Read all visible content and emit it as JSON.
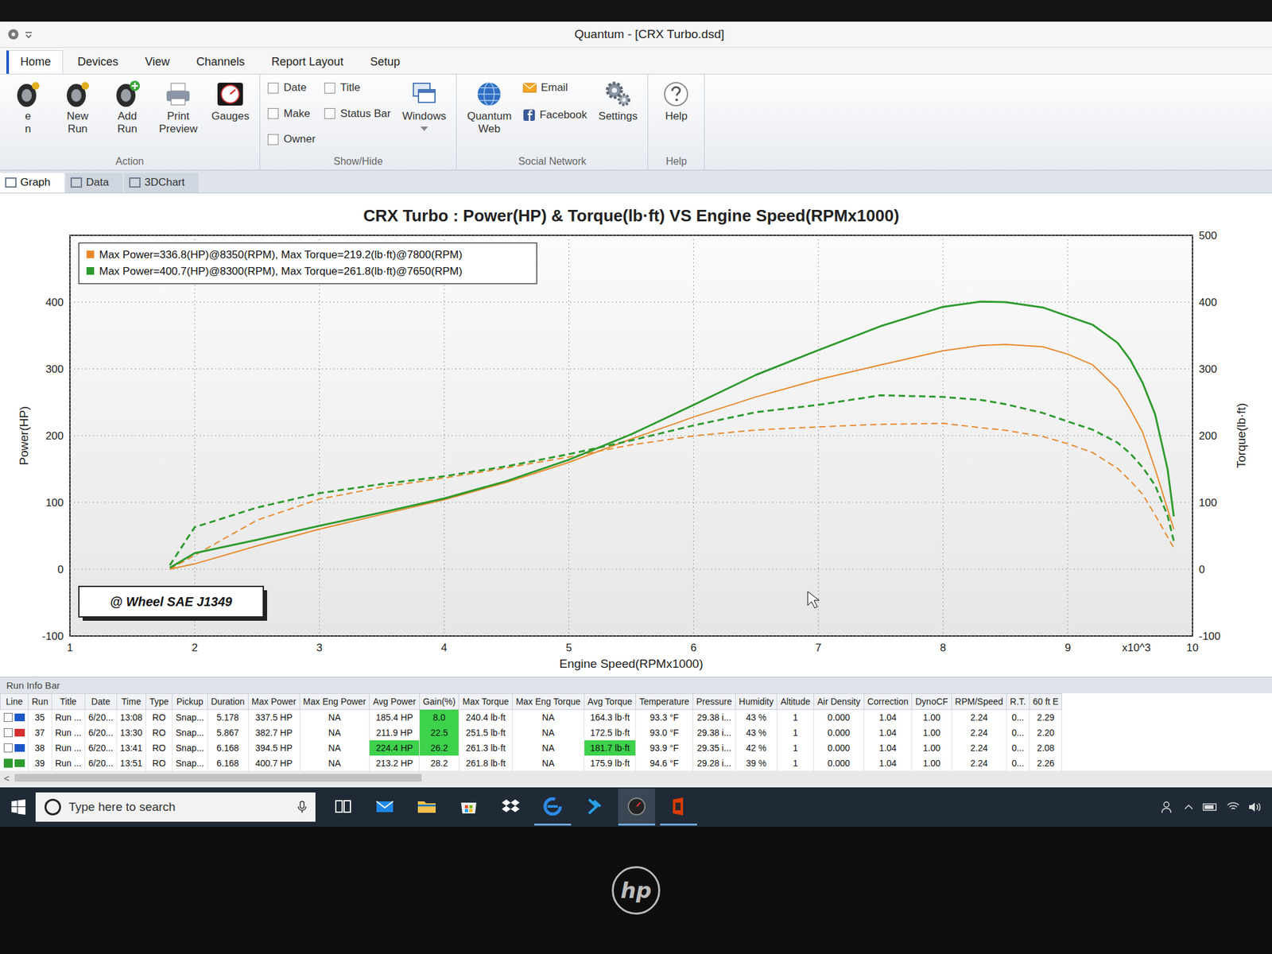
{
  "window": {
    "title": "Quantum - [CRX Turbo.dsd]"
  },
  "ribbon_tabs": [
    {
      "label": "Home",
      "selected": true
    },
    {
      "label": "Devices",
      "selected": false
    },
    {
      "label": "View",
      "selected": false
    },
    {
      "label": "Channels",
      "selected": false
    },
    {
      "label": "Report Layout",
      "selected": false
    },
    {
      "label": "Setup",
      "selected": false
    }
  ],
  "ribbon_groups": [
    {
      "label": "Action",
      "items": [
        {
          "kind": "tire",
          "lines": [
            "e",
            "n"
          ]
        },
        {
          "kind": "tire",
          "lines": [
            "New",
            "Run"
          ]
        },
        {
          "kind": "tireadd",
          "lines": [
            "Add",
            "Run"
          ]
        },
        {
          "kind": "printer",
          "lines": [
            "Print",
            "Preview"
          ]
        },
        {
          "kind": "gauge",
          "lines": [
            "Gauges"
          ]
        }
      ]
    },
    {
      "label": "Show/Hide",
      "items": [
        {
          "kind": "checkbox",
          "label": "Date",
          "checked": false
        },
        {
          "kind": "checkbox",
          "label": "Make",
          "checked": false
        },
        {
          "kind": "checkbox",
          "label": "Owner",
          "checked": false
        },
        {
          "kind": "checkbox",
          "label": "Title",
          "checked": false
        },
        {
          "kind": "checkbox",
          "label": "Status Bar",
          "checked": false
        },
        {
          "kind": "windows",
          "lines": [
            "Windows"
          ]
        }
      ]
    },
    {
      "label": "Social Network",
      "items": [
        {
          "kind": "globe",
          "lines": [
            "Quantum",
            "Web"
          ]
        },
        {
          "kind": "email",
          "lines": [
            "Email"
          ]
        },
        {
          "kind": "facebook",
          "lines": [
            "Facebook"
          ]
        },
        {
          "kind": "gear",
          "lines": [
            "Settings"
          ]
        }
      ]
    },
    {
      "label": "Help",
      "items": [
        {
          "kind": "help",
          "lines": [
            "Help"
          ]
        }
      ]
    }
  ],
  "view_tabs": [
    {
      "label": "Graph",
      "selected": true
    },
    {
      "label": "Data",
      "selected": false
    },
    {
      "label": "3DChart",
      "selected": false
    }
  ],
  "chart": {
    "title": "CRX Turbo : Power(HP) & Torque(lb·ft) VS Engine Speed(RPMx1000)",
    "x_label": "Engine Speed(RPMx1000)",
    "x_multiplier": "x10^3",
    "y_left_label": "Power(HP)",
    "y_right_label": "Torque(lb·ft)",
    "x_ticks": [
      "1",
      "2",
      "3",
      "4",
      "5",
      "6",
      "7",
      "8",
      "9",
      "10"
    ],
    "y_left_ticks": [
      "-100",
      "0",
      "100",
      "200",
      "300",
      "400"
    ],
    "y_right_ticks": [
      "-100",
      "0",
      "100",
      "200",
      "300",
      "400",
      "500"
    ],
    "legend": [
      {
        "text": "Max Power=336.8(HP)@8350(RPM), Max Torque=219.2(lb·ft)@7800(RPM)",
        "color": "#e8892b"
      },
      {
        "text": "Max Power=400.7(HP)@8300(RPM), Max Torque=261.8(lb·ft)@7650(RPM)",
        "color": "#2e9a2e"
      }
    ],
    "note": "@ Wheel SAE J1349",
    "rpm": [
      1.8,
      2,
      2.5,
      3,
      3.5,
      4,
      4.5,
      5,
      5.5,
      6,
      6.5,
      7,
      7.5,
      8,
      8.3,
      8.5,
      8.8,
      9,
      9.2,
      9.4,
      9.5,
      9.6,
      9.7,
      9.8,
      9.85
    ],
    "series": [
      {
        "kind": "torque",
        "color": "#e8892b",
        "values": [
          0,
          21,
          73.5,
          105,
          123,
          136.6,
          151.7,
          168.1,
          186.2,
          199.6,
          208.5,
          213.1,
          217,
          218.5,
          212,
          208.1,
          198.7,
          187.9,
          174.7,
          150.8,
          132.7,
          112.2,
          81.2,
          48.2,
          32
        ]
      },
      {
        "kind": "power",
        "color": "#e8892b",
        "values": [
          0,
          8,
          35,
          60,
          82,
          104,
          130,
          160,
          195,
          228,
          258,
          284,
          306,
          327,
          335,
          336.8,
          333,
          322,
          306,
          270,
          240,
          205,
          150,
          90,
          60
        ]
      },
      {
        "kind": "torque",
        "color": "#2e9a2e",
        "values": [
          5.8,
          63,
          92.4,
          113.8,
          127.5,
          139.2,
          154.1,
          172.3,
          192.9,
          215.3,
          235.1,
          246.1,
          260.5,
          258,
          253.5,
          247.2,
          234,
          221.2,
          208.9,
          189.4,
          173.6,
          152.6,
          125.6,
          80.4,
          42.1
        ]
      },
      {
        "kind": "power",
        "color": "#2e9a2e",
        "values": [
          2,
          24,
          44,
          65,
          85,
          106,
          132,
          164,
          202,
          246,
          291,
          328,
          364,
          393,
          400.7,
          400,
          392,
          379,
          366,
          339,
          314,
          279,
          232,
          150,
          79
        ]
      }
    ]
  },
  "run_info": {
    "title": "Run Info Bar",
    "columns": [
      "Line",
      "Run",
      "Title",
      "Date",
      "Time",
      "Type",
      "Pickup",
      "Duration",
      "Max Power",
      "Max Eng Power",
      "Avg Power",
      "Gain(%)",
      "Max Torque",
      "Max Eng Torque",
      "Avg Torque",
      "Temperature",
      "Pressure",
      "Humidity",
      "Altitude",
      "Air Density",
      "Correction",
      "DynoCF",
      "RPM/Speed",
      "R.T.",
      "60 ft E"
    ],
    "rows": [
      {
        "checked": false,
        "color": "#1d57c8",
        "highlighted": [
          10
        ],
        "cells": [
          "35",
          "Run ...",
          "6/20...",
          "13:08",
          "RO",
          "Snap...",
          "5.178",
          "337.5 HP",
          "NA",
          "185.4 HP",
          "8.0",
          "240.4 lb·ft",
          "NA",
          "164.3 lb·ft",
          "93.3 °F",
          "29.38 i...",
          "43 %",
          "1",
          "0.000",
          "1.04",
          "1.00",
          "2.24",
          "0...",
          "2.29"
        ]
      },
      {
        "checked": false,
        "color": "#d32f2f",
        "highlighted": [
          10
        ],
        "cells": [
          "37",
          "Run ...",
          "6/20...",
          "13:30",
          "RO",
          "Snap...",
          "5.867",
          "382.7 HP",
          "NA",
          "211.9 HP",
          "22.5",
          "251.5 lb·ft",
          "NA",
          "172.5 lb·ft",
          "93.0 °F",
          "29.38 i...",
          "43 %",
          "1",
          "0.000",
          "1.04",
          "1.00",
          "2.24",
          "0...",
          "2.20"
        ]
      },
      {
        "checked": false,
        "color": "#1d57c8",
        "highlighted": [
          9,
          10,
          13
        ],
        "cells": [
          "38",
          "Run ...",
          "6/20...",
          "13:41",
          "RO",
          "Snap...",
          "6.168",
          "394.5 HP",
          "NA",
          "224.4 HP",
          "26.2",
          "261.3 lb·ft",
          "NA",
          "181.7 lb·ft",
          "93.9 °F",
          "29.35 i...",
          "42 %",
          "1",
          "0.000",
          "1.04",
          "1.00",
          "2.24",
          "0...",
          "2.08"
        ]
      },
      {
        "checked": true,
        "color": "#2e9a2e",
        "highlighted": [],
        "cells": [
          "39",
          "Run ...",
          "6/20...",
          "13:51",
          "RO",
          "Snap...",
          "6.168",
          "400.7 HP",
          "NA",
          "213.2 HP",
          "28.2",
          "261.8 lb·ft",
          "NA",
          "175.9 lb·ft",
          "94.6 °F",
          "29.28 i...",
          "39 %",
          "1",
          "0.000",
          "1.04",
          "1.00",
          "2.24",
          "0...",
          "2.26"
        ]
      }
    ],
    "scroll_glyph": "<"
  },
  "taskbar": {
    "search_placeholder": "Type here to search",
    "apps": [
      {
        "kind": "taskview",
        "open": false
      },
      {
        "kind": "mail",
        "open": false
      },
      {
        "kind": "explorer",
        "open": false
      },
      {
        "kind": "store",
        "open": false
      },
      {
        "kind": "dropbox",
        "open": false
      },
      {
        "kind": "edge",
        "open": true
      },
      {
        "kind": "chevron",
        "open": false
      },
      {
        "kind": "gauge",
        "open": true
      },
      {
        "kind": "office",
        "open": true
      }
    ]
  },
  "bezel": {
    "logo": "hp"
  }
}
